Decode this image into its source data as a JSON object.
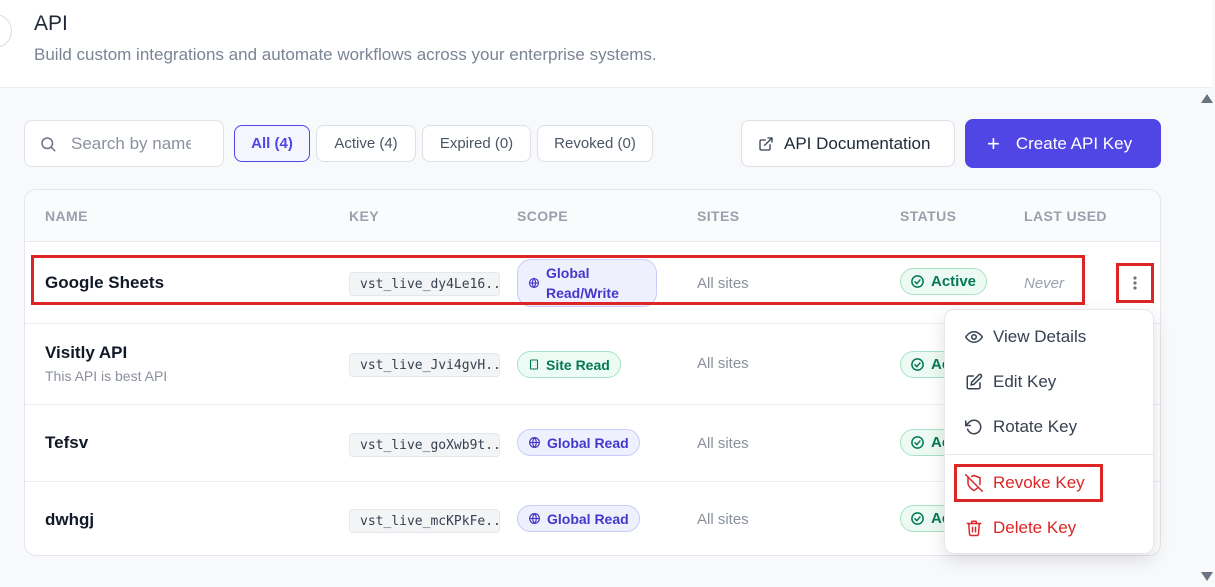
{
  "header": {
    "title": "API",
    "subtitle": "Build custom integrations and automate workflows across your enterprise systems."
  },
  "toolbar": {
    "search_placeholder": "Search by name",
    "filters": [
      {
        "label": "All (4)",
        "active": true
      },
      {
        "label": "Active (4)",
        "active": false
      },
      {
        "label": "Expired (0)",
        "active": false
      },
      {
        "label": "Revoked (0)",
        "active": false
      }
    ],
    "docs_label": "API Documentation",
    "create_label": "Create API Key"
  },
  "table": {
    "columns": [
      "NAME",
      "KEY",
      "SCOPE",
      "SITES",
      "STATUS",
      "LAST USED"
    ],
    "rows": [
      {
        "name": "Google Sheets",
        "description": "",
        "key": "vst_live_dy4Le16...",
        "scope": "Global Read/Write",
        "sites": "All sites",
        "status": "Active",
        "last_used": "Never"
      },
      {
        "name": "Visitly API",
        "description": "This API is best API",
        "key": "vst_live_Jvi4gvH...",
        "scope": "Site Read",
        "sites": "All sites",
        "status": "Active",
        "last_used": ""
      },
      {
        "name": "Tefsv",
        "description": "",
        "key": "vst_live_goXwb9t...",
        "scope": "Global Read",
        "sites": "All sites",
        "status": "Active",
        "last_used": ""
      },
      {
        "name": "dwhgj",
        "description": "",
        "key": "vst_live_mcKPkFe...",
        "scope": "Global Read",
        "sites": "All sites",
        "status": "Active",
        "last_used": ""
      }
    ]
  },
  "row_menu": {
    "items": [
      {
        "label": "View Details",
        "icon": "eye-icon",
        "danger": false
      },
      {
        "label": "Edit Key",
        "icon": "edit-icon",
        "danger": false
      },
      {
        "label": "Rotate Key",
        "icon": "rotate-icon",
        "danger": false
      },
      {
        "label": "Revoke Key",
        "icon": "shield-off-icon",
        "danger": true
      },
      {
        "label": "Delete Key",
        "icon": "trash-icon",
        "danger": true
      }
    ]
  },
  "colors": {
    "accent": "#4f46e5",
    "danger": "#dc2626",
    "success": "#047857",
    "highlight_box": "#dc2626"
  }
}
